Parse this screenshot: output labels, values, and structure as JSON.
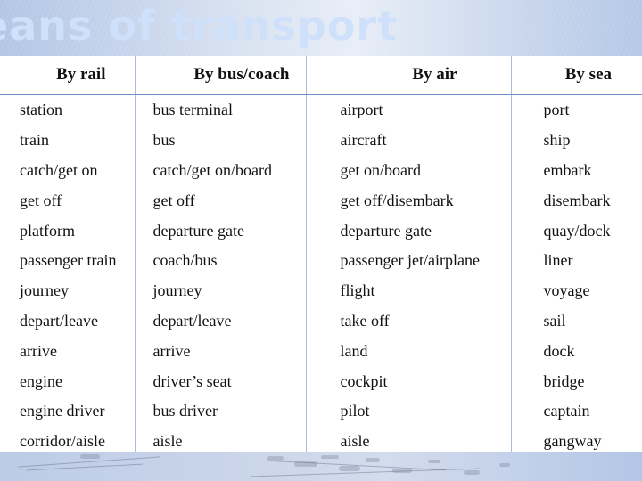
{
  "slide": {
    "title_fragment": "eans of transport"
  },
  "table": {
    "headers": [
      "By rail",
      "By bus/coach",
      "By air",
      "By sea"
    ],
    "rows": [
      [
        "station",
        "bus terminal",
        "airport",
        "port"
      ],
      [
        "train",
        "bus",
        "aircraft",
        "ship"
      ],
      [
        "catch/get on",
        "catch/get on/board",
        "get on/board",
        "embark"
      ],
      [
        "get off",
        "get off",
        "get off/disembark",
        "disembark"
      ],
      [
        "platform",
        "departure gate",
        "departure gate",
        "quay/dock"
      ],
      [
        "passenger train",
        "coach/bus",
        "passenger jet/airplane",
        "liner"
      ],
      [
        "journey",
        "journey",
        "flight",
        "voyage"
      ],
      [
        "depart/leave",
        "depart/leave",
        "take off",
        "sail"
      ],
      [
        "arrive",
        "arrive",
        "land",
        "dock"
      ],
      [
        "engine",
        "driver’s seat",
        "cockpit",
        "bridge"
      ],
      [
        "engine driver",
        "bus driver",
        "pilot",
        "captain"
      ],
      [
        "corridor/aisle",
        "aisle",
        "aisle",
        "gangway"
      ]
    ]
  }
}
